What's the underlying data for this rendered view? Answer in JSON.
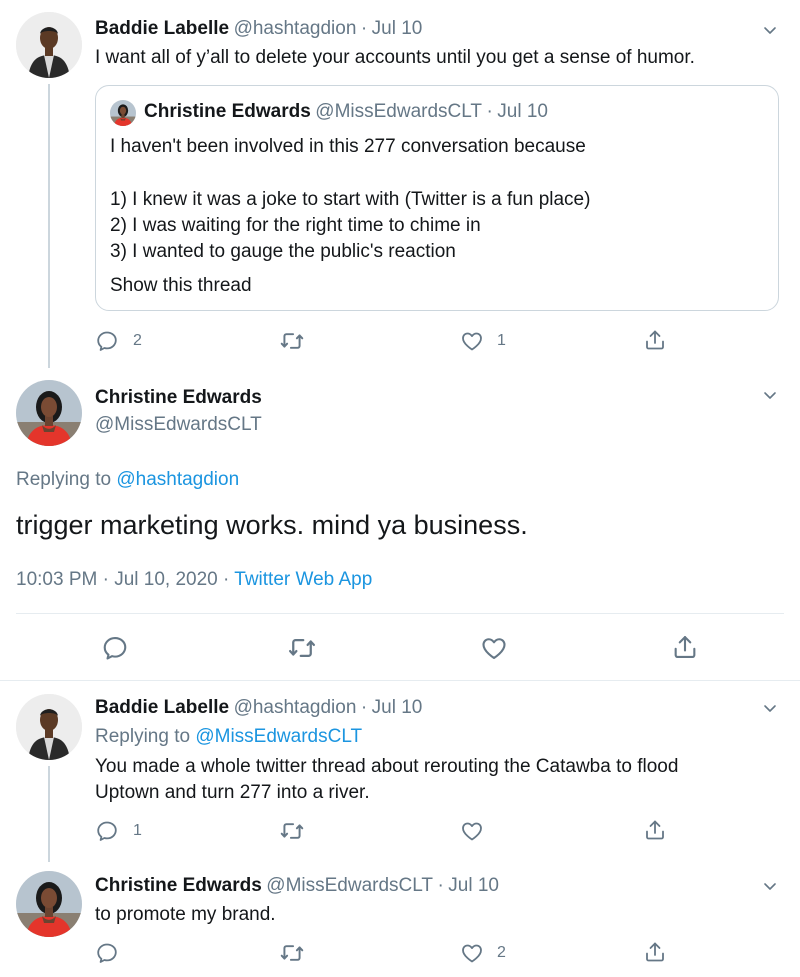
{
  "tweet1": {
    "name": "Baddie Labelle",
    "handle": "@hashtagdion",
    "dot": "·",
    "date": "Jul 10",
    "text": "I want all of y’all to delete your accounts until you get a sense of humor.",
    "reply_count": "2",
    "like_count": "1"
  },
  "quote": {
    "name": "Christine Edwards",
    "handle": "@MissEdwardsCLT",
    "dot": "·",
    "date": "Jul 10",
    "line1": "I haven't been involved in this 277 conversation because",
    "line2": "1) I knew it was a joke to start with (Twitter is a fun place)",
    "line3": "2) I was waiting for the right time to chime in",
    "line4": "3) I wanted to gauge the public's reaction",
    "show_thread": "Show this thread"
  },
  "main_tweet": {
    "name": "Christine Edwards",
    "handle": "@MissEdwardsCLT",
    "replying_prefix": "Replying to",
    "replying_handle": "@hashtagdion",
    "text": "trigger marketing works. mind ya business.",
    "time": "10:03 PM · Jul 10, 2020 ·",
    "source": "Twitter Web App"
  },
  "tweet3": {
    "name": "Baddie Labelle",
    "handle": "@hashtagdion",
    "dot": "·",
    "date": "Jul 10",
    "replying_prefix": "Replying to",
    "replying_handle": "@MissEdwardsCLT",
    "line1": "You made a whole twitter thread about rerouting the Catawba to flood",
    "line2": "Uptown and turn 277 into a river.",
    "reply_count": "1"
  },
  "tweet4": {
    "name": "Christine Edwards",
    "handle": "@MissEdwardsCLT",
    "dot": "·",
    "date": "Jul 10",
    "text": "to promote my brand.",
    "like_count": "2"
  },
  "colors": {
    "link": "#1b95e0",
    "muted": "#657786",
    "border": "#ccd6dd"
  }
}
